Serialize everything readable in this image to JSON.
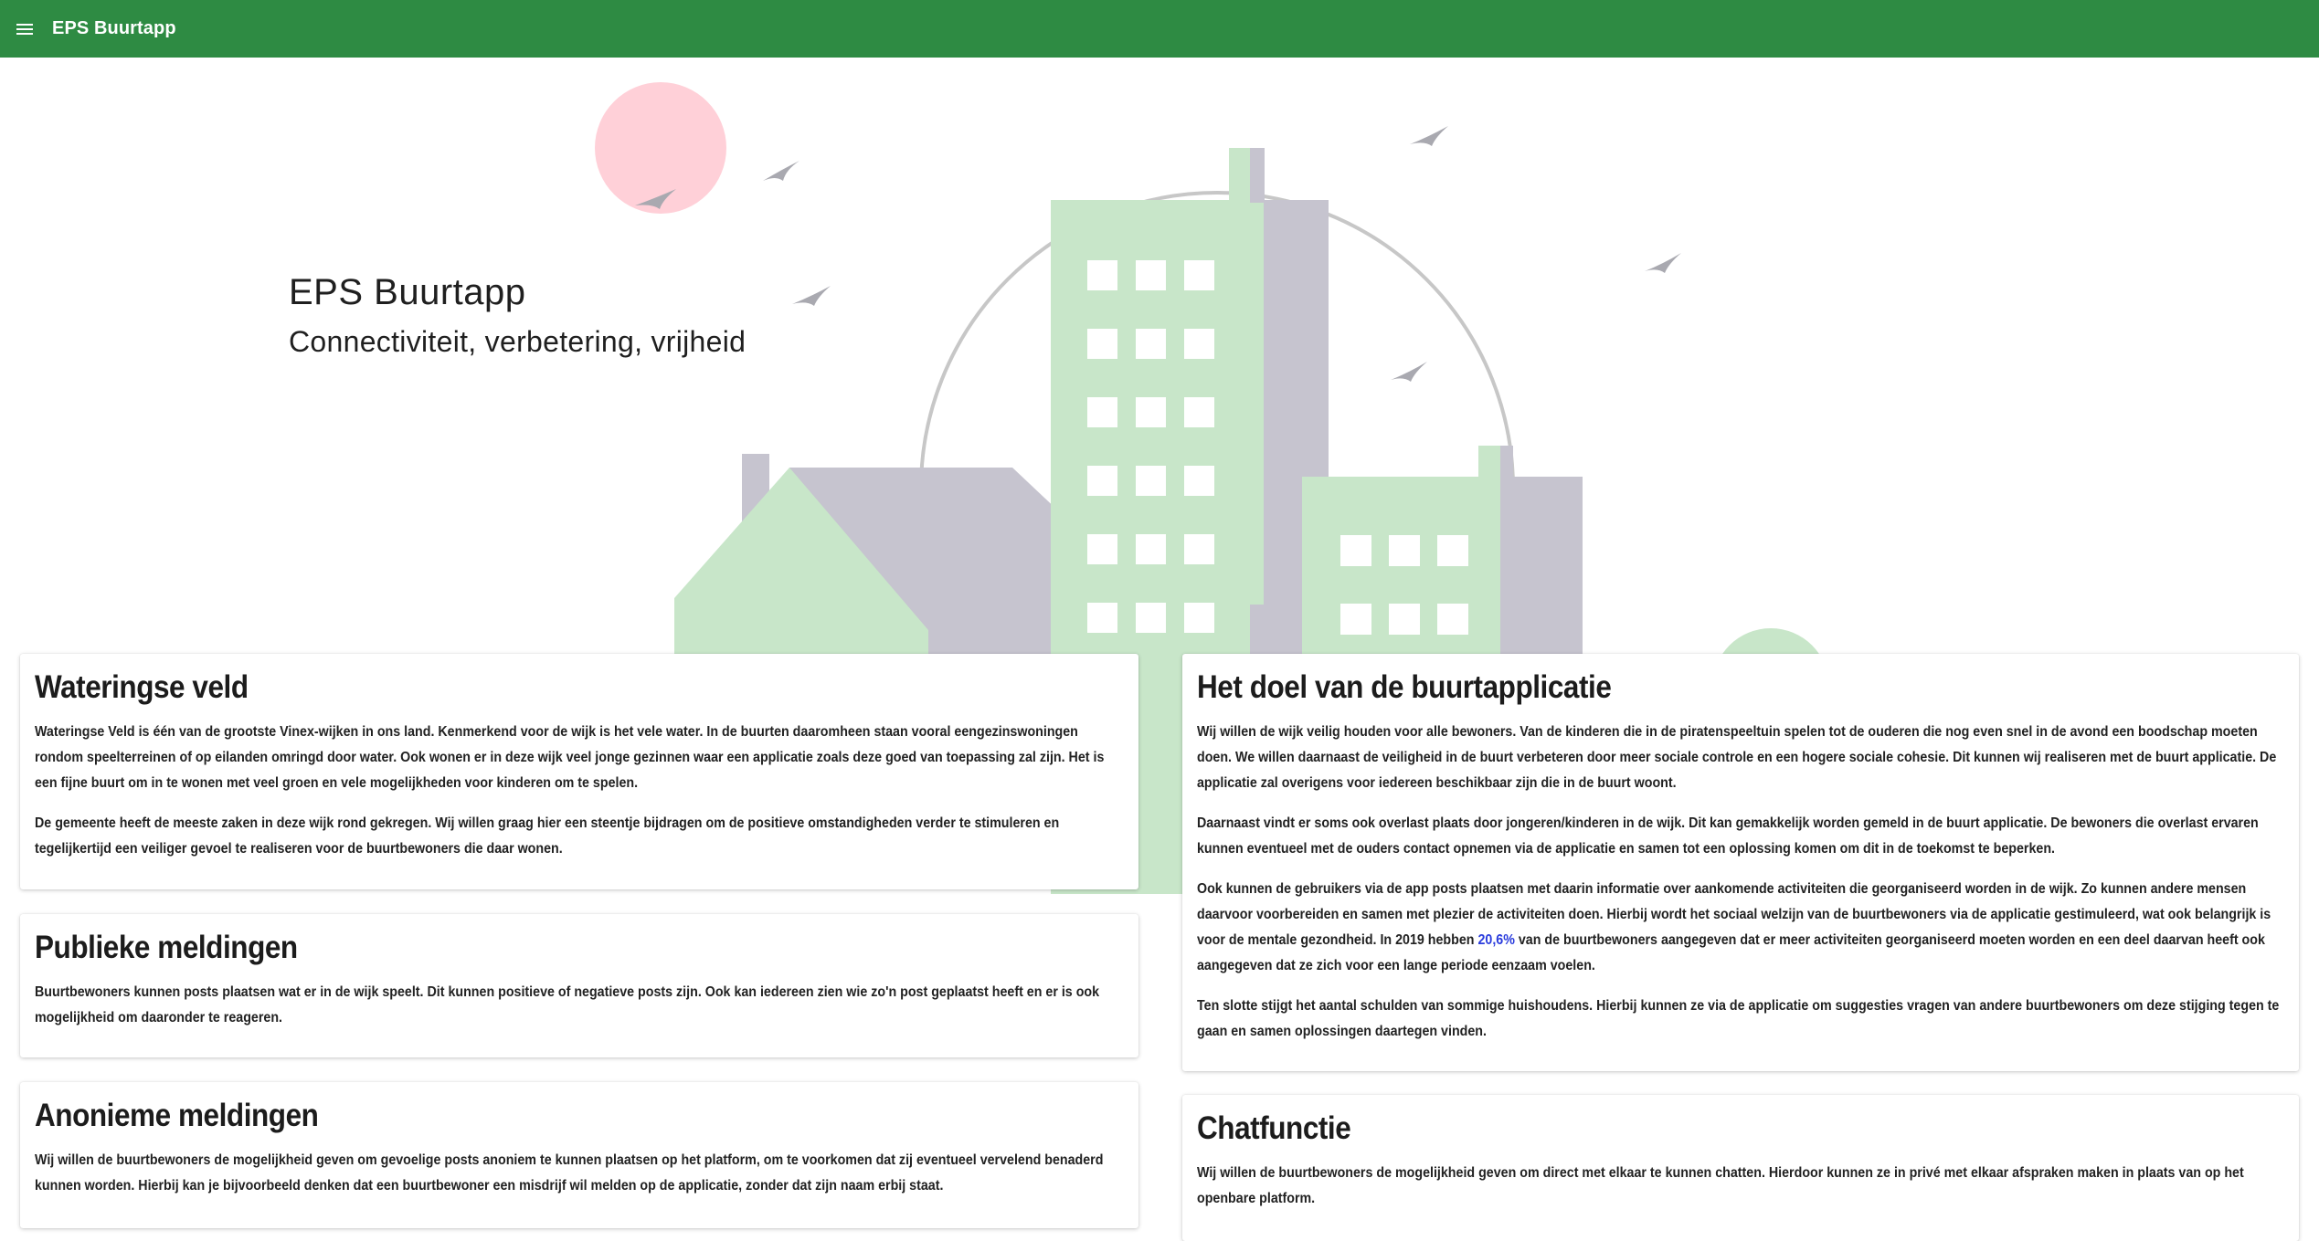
{
  "app": {
    "title": "EPS Buurtapp"
  },
  "topbar": {
    "menu_icon": "menu-icon",
    "color": "#2e8b43"
  },
  "hero": {
    "title": "EPS Buurtapp",
    "subtitle": "Connectiviteit, verbetering, vrijheid",
    "colors": {
      "building_green": "#c8e6c9",
      "building_gray": "#c6c4cf",
      "sun": "#ffd0d8",
      "bird": "#a9a9b0"
    }
  },
  "cards": {
    "wateringse": {
      "title": "Wateringse veld",
      "p1": "Wateringse Veld is één van de grootste Vinex-wijken in ons land. Kenmerkend voor de wijk is het vele water. In de buurten daaromheen staan vooral eengezinswoningen rondom speelterreinen of op eilanden omringd door water. Ook wonen er in deze wijk veel jonge gezinnen waar een applicatie zoals deze goed van toepassing zal zijn. Het is een fijne buurt om in te wonen met veel groen en vele mogelijkheden voor kinderen om te spelen.",
      "p2": "De gemeente heeft de meeste zaken in deze wijk rond gekregen. Wij willen graag hier een steentje bijdragen om de positieve omstandigheden verder te stimuleren en tegelijkertijd een veiliger gevoel te realiseren voor de buurtbewoners die daar wonen."
    },
    "publieke": {
      "title": "Publieke meldingen",
      "p1": "Buurtbewoners kunnen posts plaatsen wat er in de wijk speelt. Dit kunnen positieve of negatieve posts zijn. Ook kan iedereen zien wie zo'n post geplaatst heeft en er is ook mogelijkheid om daaronder te reageren."
    },
    "anonieme": {
      "title": "Anonieme meldingen",
      "p1": "Wij willen de buurtbewoners de mogelijkheid geven om gevoelige posts anoniem te kunnen plaatsen op het platform, om te voorkomen dat zij eventueel vervelend benaderd kunnen worden. Hierbij kan je bijvoorbeeld denken dat een buurtbewoner een misdrijf wil melden op de applicatie, zonder dat zijn naam erbij staat."
    },
    "doel": {
      "title": "Het doel van de buurtapplicatie",
      "p1": "Wij willen de wijk veilig houden voor alle bewoners. Van de kinderen die in de piratenspeeltuin spelen tot de ouderen die nog even snel in de avond een boodschap moeten doen. We willen daarnaast de veiligheid in de buurt verbeteren door meer sociale controle en een hogere sociale cohesie. Dit kunnen wij realiseren met de buurt applicatie. De applicatie zal overigens voor iedereen beschikbaar zijn die in de buurt woont.",
      "p2": "Daarnaast vindt er soms ook overlast plaats door jongeren/kinderen in de wijk. Dit kan gemakkelijk worden gemeld in de buurt applicatie. De bewoners die overlast ervaren kunnen eventueel met de ouders contact opnemen via de applicatie en samen tot een oplossing komen om dit in de toekomst te beperken.",
      "p3_before": "Ook kunnen de gebruikers via de app posts plaatsen met daarin informatie over aankomende activiteiten die georganiseerd worden in de wijk. Zo kunnen andere mensen daarvoor voorbereiden en samen met plezier de activiteiten doen. Hierbij wordt het sociaal welzijn van de buurtbewoners via de applicatie gestimuleerd, wat ook belangrijk is voor de mentale gezondheid. In 2019 hebben ",
      "p3_highlight": "20,6%",
      "p3_after": " van de buurtbewoners aangegeven dat er meer activiteiten georganiseerd moeten worden en een deel daarvan heeft ook aangegeven dat ze zich voor een lange periode eenzaam voelen.",
      "p4": "Ten slotte stijgt het aantal schulden van sommige huishoudens. Hierbij kunnen ze via de applicatie om suggesties vragen van andere buurtbewoners om deze stijging tegen te gaan en samen oplossingen daartegen vinden.",
      "highlight_color": "#2a3cdd"
    },
    "chat": {
      "title": "Chatfunctie",
      "p1": "Wij willen de buurtbewoners de mogelijkheid geven om direct met elkaar te kunnen chatten. Hierdoor kunnen ze in privé met elkaar afspraken maken in plaats van op het openbare platform."
    }
  }
}
